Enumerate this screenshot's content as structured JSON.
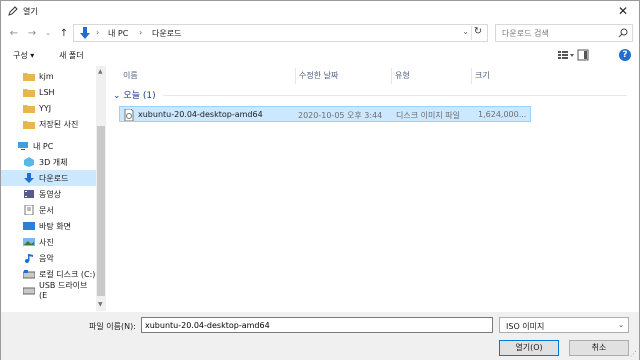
{
  "window": {
    "title": "열기"
  },
  "address": {
    "crumbs": [
      "내 PC",
      "다운로드"
    ],
    "search_placeholder": "다운로드 검색"
  },
  "toolbar": {
    "organize_label": "구성 ▾",
    "new_folder_label": "새 폴더",
    "help_label": "?"
  },
  "nav": {
    "items": [
      {
        "label": "kjm",
        "icon": "folder-icon"
      },
      {
        "label": "LSH",
        "icon": "folder-icon"
      },
      {
        "label": "YYJ",
        "icon": "folder-icon"
      },
      {
        "label": "저장된 사진",
        "icon": "folder-icon"
      },
      {
        "label": "내 PC",
        "icon": "pc-icon"
      },
      {
        "label": "3D 개체",
        "icon": "3d-objects-icon"
      },
      {
        "label": "다운로드",
        "icon": "download-icon",
        "selected": true
      },
      {
        "label": "동영상",
        "icon": "video-icon"
      },
      {
        "label": "문서",
        "icon": "document-icon"
      },
      {
        "label": "바탕 화면",
        "icon": "desktop-icon"
      },
      {
        "label": "사진",
        "icon": "pictures-icon"
      },
      {
        "label": "음악",
        "icon": "music-icon"
      },
      {
        "label": "로컬 디스크 (C:)",
        "icon": "local-disk-icon"
      },
      {
        "label": "USB 드라이브 (E",
        "icon": "usb-drive-icon"
      }
    ]
  },
  "columns": {
    "name": "이름",
    "date": "수정한 날짜",
    "type": "유형",
    "size": "크기"
  },
  "group": {
    "label": "오늘 (1)"
  },
  "files": [
    {
      "name": "xubuntu-20.04-desktop-amd64",
      "date": "2020-10-05 오후 3:44",
      "type": "디스크 이미지 파일",
      "size": "1,624,000..."
    }
  ],
  "bottom": {
    "filename_label": "파일 이름(N):",
    "filename_value": "xubuntu-20.04-desktop-amd64",
    "filter_value": "ISO 이미지",
    "open_label": "열기(O)",
    "cancel_label": "취소"
  },
  "colors": {
    "accent": "#0078d7",
    "selection": "#cce8ff",
    "folder": "#e8b64a"
  }
}
